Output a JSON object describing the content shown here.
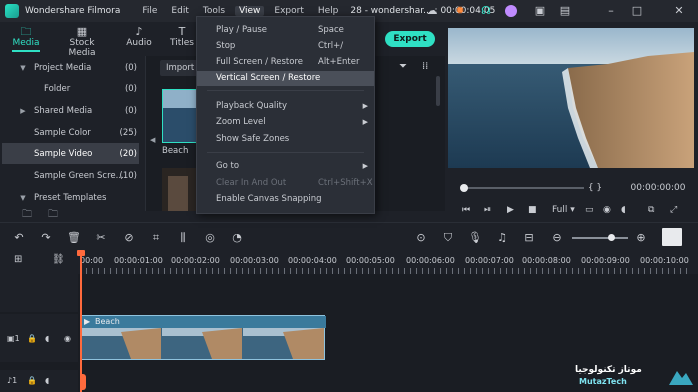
{
  "app": {
    "name": "Wondershare Filmora",
    "menus": [
      "File",
      "Edit",
      "Tools",
      "View",
      "Export",
      "Help"
    ],
    "doc_title": "28 - wondershar... : 00:00:04:05"
  },
  "media_tabs": [
    {
      "label": "Media",
      "icon": "folder-icon"
    },
    {
      "label": "Stock Media",
      "icon": "stock-media-icon"
    },
    {
      "label": "Audio",
      "icon": "music-note-icon"
    },
    {
      "label": "Titles",
      "icon": "titles-icon"
    }
  ],
  "library": [
    {
      "label": "Project Media",
      "count": "(0)",
      "arrow": "▼"
    },
    {
      "label": "Folder",
      "count": "(0)",
      "arrow": ""
    },
    {
      "label": "Shared Media",
      "count": "(0)",
      "arrow": "▶"
    },
    {
      "label": "Sample Color",
      "count": "(25)",
      "arrow": ""
    },
    {
      "label": "Sample Video",
      "count": "(20)",
      "arrow": ""
    },
    {
      "label": "Sample Green Scre...",
      "count": "(10)",
      "arrow": ""
    },
    {
      "label": "Preset Templates",
      "count": "",
      "arrow": "▼"
    }
  ],
  "browser": {
    "import_label": "Import",
    "clip_name": "Beach"
  },
  "view_menu": {
    "items": [
      {
        "label": "Play / Pause",
        "shortcut": "Space",
        "submenu": false,
        "state": "normal"
      },
      {
        "label": "Stop",
        "shortcut": "Ctrl+/",
        "submenu": false,
        "state": "normal"
      },
      {
        "label": "Full Screen / Restore",
        "shortcut": "Alt+Enter",
        "submenu": false,
        "state": "normal"
      },
      {
        "label": "Vertical Screen / Restore",
        "shortcut": "",
        "submenu": false,
        "state": "highlighted"
      },
      {
        "label": "Playback Quality",
        "shortcut": "",
        "submenu": true,
        "state": "normal"
      },
      {
        "label": "Zoom Level",
        "shortcut": "",
        "submenu": true,
        "state": "normal"
      },
      {
        "label": "Show Safe Zones",
        "shortcut": "",
        "submenu": false,
        "state": "normal"
      },
      {
        "label": "Go to",
        "shortcut": "",
        "submenu": true,
        "state": "normal"
      },
      {
        "label": "Clear In And Out",
        "shortcut": "Ctrl+Shift+X",
        "submenu": false,
        "state": "disabled"
      },
      {
        "label": "Enable Canvas Snapping",
        "shortcut": "",
        "submenu": false,
        "state": "normal"
      }
    ]
  },
  "export_label": "Export",
  "preview": {
    "timecode": "00:00:00:00",
    "quality": "Full",
    "brackets": "{   }"
  },
  "timeline": {
    "ticks": [
      "00:00",
      "00:00:01:00",
      "00:00:02:00",
      "00:00:03:00",
      "00:00:04:00",
      "00:00:05:00",
      "00:00:06:00",
      "00:00:07:00",
      "00:00:08:00",
      "00:00:09:00",
      "00:00:10:00"
    ],
    "clip_label": "Beach",
    "track_video": "1",
    "track_audio": "1"
  },
  "watermark": {
    "arabic": "موتاز تكنولوجيا",
    "latin": "MutazTech"
  },
  "colors": {
    "accent": "#2fe0c4",
    "playhead": "#ff6a3d",
    "bg": "#1e2128"
  }
}
